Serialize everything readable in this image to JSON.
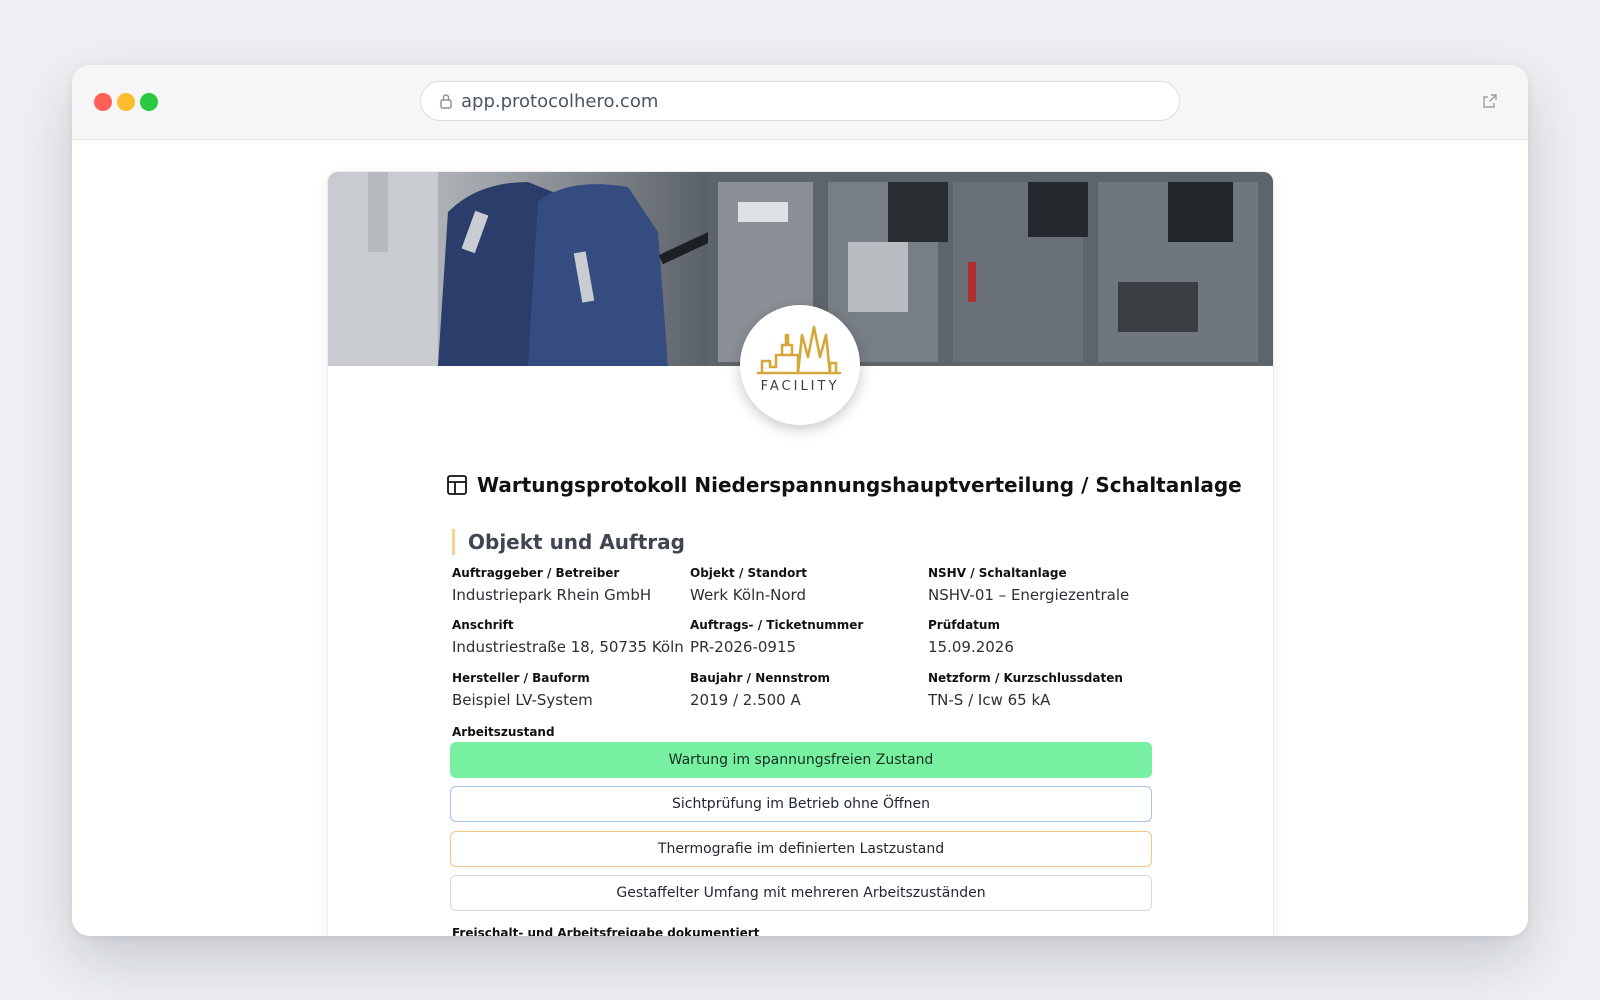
{
  "browser": {
    "url": "app.protocolhero.com"
  },
  "logo": {
    "text": "FACILITY",
    "accent_color": "#d4a83a"
  },
  "document": {
    "title": "Wartungsprotokoll Niederspannungshauptverteilung / Schaltanlage"
  },
  "section": {
    "heading": "Objekt und Auftrag",
    "fields": [
      {
        "label": "Auftraggeber / Betreiber",
        "value": "Industriepark Rhein GmbH"
      },
      {
        "label": "Objekt / Standort",
        "value": "Werk Köln-Nord"
      },
      {
        "label": "NSHV / Schaltanlage",
        "value": "NSHV-01 – Energiezentrale"
      },
      {
        "label": "Anschrift",
        "value": "Industriestraße 18, 50735 Köln"
      },
      {
        "label": "Auftrags- / Ticketnummer",
        "value": "PR-2026-0915"
      },
      {
        "label": "Prüfdatum",
        "value": "15.09.2026"
      },
      {
        "label": "Hersteller / Bauform",
        "value": "Beispiel LV-System"
      },
      {
        "label": "Baujahr / Nennstrom",
        "value": "2019 / 2.500 A"
      },
      {
        "label": "Netzform / Kurzschlussdaten",
        "value": "TN-S / Icw 65 kA"
      }
    ],
    "arbeitszustand": {
      "label": "Arbeitszustand",
      "options": [
        {
          "label": "Wartung im spannungsfreien Zustand",
          "selected": true,
          "color": "#78f0a2"
        },
        {
          "label": "Sichtprüfung im Betrieb ohne Öffnen",
          "selected": false,
          "color": "#9fc2ea"
        },
        {
          "label": "Thermografie im definierten Lastzustand",
          "selected": false,
          "color": "#f3c68a"
        },
        {
          "label": "Gestaffelter Umfang mit mehreren Arbeitszuständen",
          "selected": false,
          "color": "#d6d9de"
        }
      ]
    },
    "next_label": "Freischalt- und Arbeitsfreigabe dokumentiert"
  }
}
